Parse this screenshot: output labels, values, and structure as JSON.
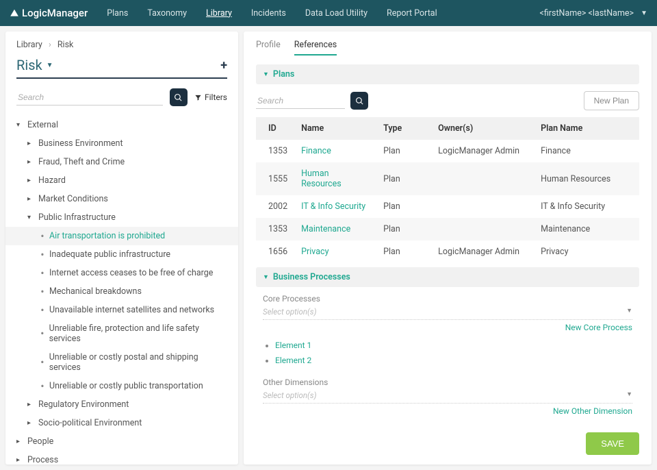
{
  "brand": "LogicManager",
  "nav": {
    "items": [
      "Plans",
      "Taxonomy",
      "Library",
      "Incidents",
      "Data Load Utility",
      "Report Portal"
    ],
    "active": 2
  },
  "user": "<firstName> <lastName>",
  "breadcrumb": {
    "a": "Library",
    "b": "Risk"
  },
  "section": {
    "title": "Risk",
    "add": "+"
  },
  "search": {
    "placeholder": "Search",
    "filters": "Filters"
  },
  "tree": {
    "external": "External",
    "children1": [
      "Business Environment",
      "Fraud, Theft and Crime",
      "Hazard",
      "Market Conditions"
    ],
    "publicInfra": "Public Infrastructure",
    "leaves": [
      "Air transportation is prohibited",
      "Inadequate public infrastructure",
      "Internet access ceases to be free of charge",
      "Mechanical breakdowns",
      "Unavailable internet satellites and networks",
      "Unreliable fire, protection and life safety services",
      "Unreliable or costly postal and shipping services",
      "Unreliable or costly public transportation"
    ],
    "after": [
      "Regulatory Environment",
      "Socio-political Environment"
    ],
    "top": [
      "People",
      "Process"
    ]
  },
  "tabs": {
    "profile": "Profile",
    "references": "References"
  },
  "plans": {
    "header": "Plans",
    "search_placeholder": "Search",
    "new": "New Plan",
    "cols": {
      "id": "ID",
      "name": "Name",
      "type": "Type",
      "owner": "Owner(s)",
      "plan_name": "Plan Name"
    },
    "rows": [
      {
        "id": "1353",
        "name": "Finance",
        "type": "Plan",
        "owner": "LogicManager Admin",
        "plan_name": "Finance"
      },
      {
        "id": "1555",
        "name": "Human Resources",
        "type": "Plan",
        "owner": "",
        "plan_name": "Human Resources"
      },
      {
        "id": "2002",
        "name": "IT & Info Security",
        "type": "Plan",
        "owner": "",
        "plan_name": "IT & Info Security"
      },
      {
        "id": "1353",
        "name": "Maintenance",
        "type": "Plan",
        "owner": "",
        "plan_name": "Maintenance"
      },
      {
        "id": "1656",
        "name": "Privacy",
        "type": "Plan",
        "owner": "LogicManager Admin",
        "plan_name": "Privacy"
      }
    ]
  },
  "bp": {
    "header": "Business Processes",
    "core": {
      "label": "Core Processes",
      "placeholder": "Select option(s)",
      "new": "New Core Process"
    },
    "elements": [
      "Element 1",
      "Element 2"
    ],
    "other": {
      "label": "Other Dimensions",
      "placeholder": "Select option(s)",
      "new": "New Other Dimension"
    }
  },
  "save": "SAVE"
}
